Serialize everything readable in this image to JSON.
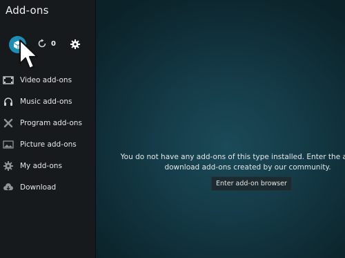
{
  "header": {
    "title": "Add-ons"
  },
  "toolbar": {
    "update_count": "0"
  },
  "sidebar": {
    "items": [
      {
        "label": "Video add-ons",
        "icon": "film-icon"
      },
      {
        "label": "Music add-ons",
        "icon": "headphones-icon"
      },
      {
        "label": "Program add-ons",
        "icon": "tools-icon"
      },
      {
        "label": "Picture add-ons",
        "icon": "picture-icon"
      },
      {
        "label": "My add-ons",
        "icon": "gear-icon"
      },
      {
        "label": "Download",
        "icon": "cloud-download-icon"
      }
    ]
  },
  "main": {
    "message_line1": "You do not have any add-ons of this type installed. Enter the add-on b",
    "message_line2": "download add-ons created by our community.",
    "browse_button": "Enter add-on browser"
  },
  "colors": {
    "accent": "#1b8fb6",
    "sidebar_bg": "#161a1c",
    "main_bg": "#143a46"
  }
}
